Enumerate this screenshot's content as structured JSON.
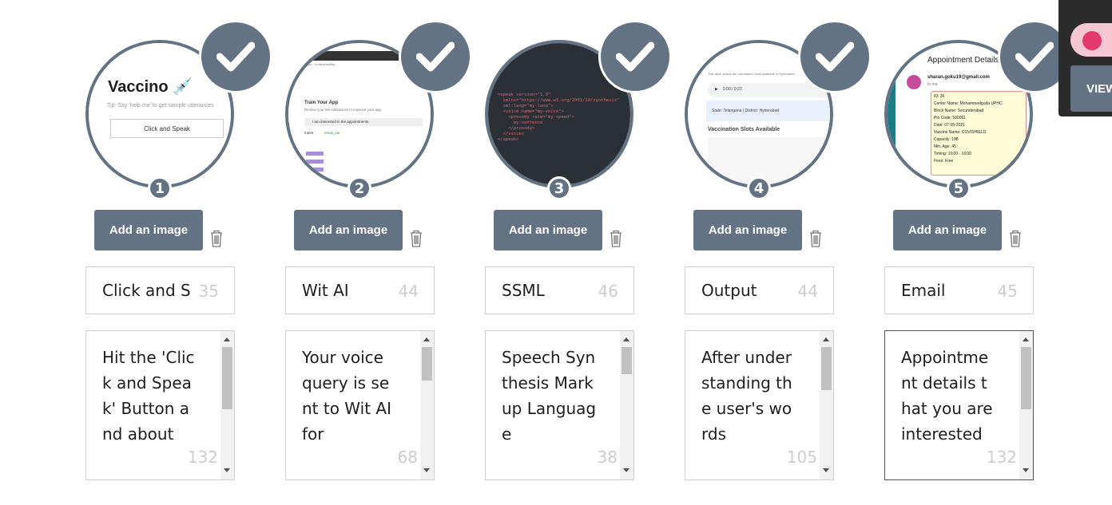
{
  "colors": {
    "accent": "#637384",
    "toggle_on": "#e3396d",
    "panel": "#2b2b2b"
  },
  "steps": [
    {
      "number": "1",
      "add_image_label": "Add an image",
      "title": "Click and S",
      "title_count": "35",
      "description": "Hit the 'Click and Speak' Button and about",
      "description_count": "132",
      "thumbnail": {
        "brand": "Vaccino",
        "tip": "Tip: Say 'help me' to get sample utterances",
        "button": "Click and Speak"
      }
    },
    {
      "number": "2",
      "add_image_label": "Add an image",
      "title": "Wit AI",
      "title_count": "44",
      "description": "Your voice query is sent to Wit AI for",
      "description_count": "68",
      "thumbnail": {
        "heading": "Train Your App",
        "sub": "Review your live utterances to improve your app.",
        "utterance": "I am interested in the appointments",
        "intent": "Intent",
        "intent_value": "email_me"
      }
    },
    {
      "number": "3",
      "add_image_label": "Add an image",
      "title": "SSML",
      "title_count": "46",
      "description": "Speech Synthesis Markup Language",
      "description_count": "38",
      "thumbnail": {
        "code": "<speak version=\"1.0\"\n  xmlns=\"https://www.w3.org/2001/10/synthesis\"\n  xml:lang=\"my-lang\">\n  <voice name=\"my-voice\">\n    <prosody rate=\"my-speed\">\n      my-sentence\n    </prosody>\n  </voice>\n</speak>"
      }
    },
    {
      "number": "4",
      "add_image_label": "Add an image",
      "title": "Output",
      "title_count": "44",
      "description": "After understanding the user's words",
      "description_count": "105",
      "thumbnail": {
        "line1": "This table shows the vaccination slots available in Hyderabad",
        "time": "0:00 / 0:22",
        "state": "State: Telangana | District: Hyderabad",
        "heading": "Vaccination Slots Available"
      }
    },
    {
      "number": "5",
      "add_image_label": "Add an image",
      "title": "Email",
      "title_count": "45",
      "description": "Appointment details that you are interested",
      "description_count": "132",
      "thumbnail": {
        "heading": "Appointment Details",
        "sender": "sharan.goku19@gmail.com",
        "to": "to me",
        "lines": [
          "ID: 36",
          "Center Name: Mohammedguda UPHC",
          "Block Name: Secunderabad",
          "Pin Code: 500061",
          "Date: 07-05-2021",
          "Vaccine Name: COVISHIELD",
          "Capacity: 198",
          "Min. Age: 45",
          "Timing: 10:00 - 16:00",
          "Fees: Free"
        ]
      }
    }
  ],
  "side_panel": {
    "view_label": "VIEW"
  }
}
